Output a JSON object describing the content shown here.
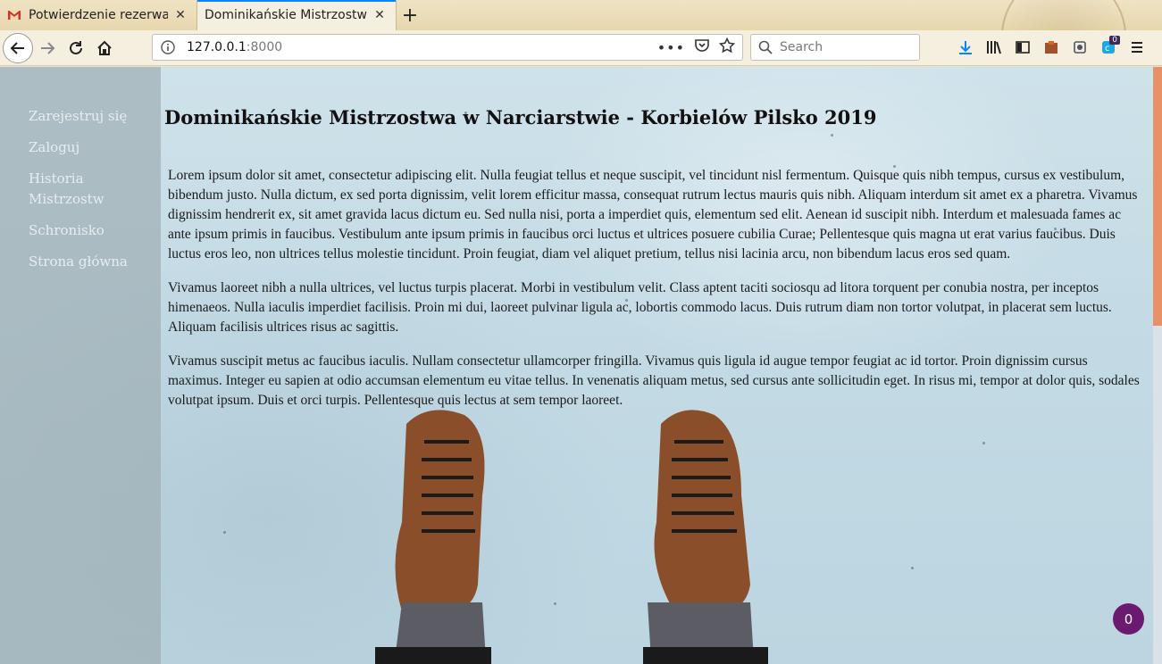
{
  "browser": {
    "tabs": [
      {
        "title": "Potwierdzenie rezerwac",
        "icon": "gmail-icon",
        "active": false
      },
      {
        "title": "Dominikańskie Mistrzostwa",
        "icon": "none",
        "active": true
      }
    ],
    "url_host": "127.0.0.1",
    "url_port": ":8000",
    "search_placeholder": "Search",
    "toolbar_badge": "0"
  },
  "sidebar": {
    "items": [
      {
        "label": "Zarejestruj się"
      },
      {
        "label": "Zaloguj"
      },
      {
        "label": "Historia Mistrzostw"
      },
      {
        "label": "Schronisko"
      },
      {
        "label": "Strona główna"
      }
    ]
  },
  "main": {
    "title": "Dominikańskie Mistrzostwa w Narciarstwie - Korbielów Pilsko 2019",
    "paragraphs": [
      "Lorem ipsum dolor sit amet, consectetur adipiscing elit. Nulla feugiat tellus et neque suscipit, vel tincidunt nisl fermentum. Quisque quis nibh tempus, cursus ex vestibulum, bibendum justo. Nulla dictum, ex sed porta dignissim, velit lorem efficitur massa, consequat rutrum lectus mauris quis nibh. Aliquam interdum sit amet ex a pharetra. Vivamus dignissim hendrerit ex, sit amet gravida lacus dictum eu. Sed nulla nisi, porta a imperdiet quis, elementum sed elit. Aenean id suscipit nibh. Interdum et malesuada fames ac ante ipsum primis in faucibus. Vestibulum ante ipsum primis in faucibus orci luctus et ultrices posuere cubilia Curae; Pellentesque quis magna ut erat varius faucibus. Duis luctus eros leo, non ultrices tellus molestie tincidunt. Proin feugiat, diam vel aliquet pretium, tellus nisi lacinia arcu, non bibendum lacus eros sed quam.",
      "Vivamus laoreet nibh a nulla ultrices, vel luctus turpis placerat. Morbi in vestibulum velit. Class aptent taciti sociosqu ad litora torquent per conubia nostra, per inceptos himenaeos. Nulla iaculis imperdiet facilisis. Proin mi dui, laoreet pulvinar ligula ac, lobortis commodo lacus. Duis rutrum diam non tortor volutpat, in placerat sem luctus. Aliquam facilisis ultrices risus ac sagittis.",
      "Vivamus suscipit metus ac faucibus iaculis. Nullam consectetur ullamcorper fringilla. Vivamus quis ligula id augue tempor feugiat ac id tortor. Proin dignissim cursus maximus. Integer eu sapien at odio accumsan elementum eu vitae tellus. In venenatis aliquam metus, sed cursus ante sollicitudin eget. In risus mi, tempor at dolor quis, sodales volutpat ipsum. Duis et orci turpis. Pellentesque quis lectus at sem tempor laoreet."
    ]
  },
  "chat": {
    "count": "0"
  },
  "colors": {
    "accent": "#0a84ff",
    "scroll_thumb": "#e89166",
    "chat_bubble": "#6a1b6f"
  }
}
